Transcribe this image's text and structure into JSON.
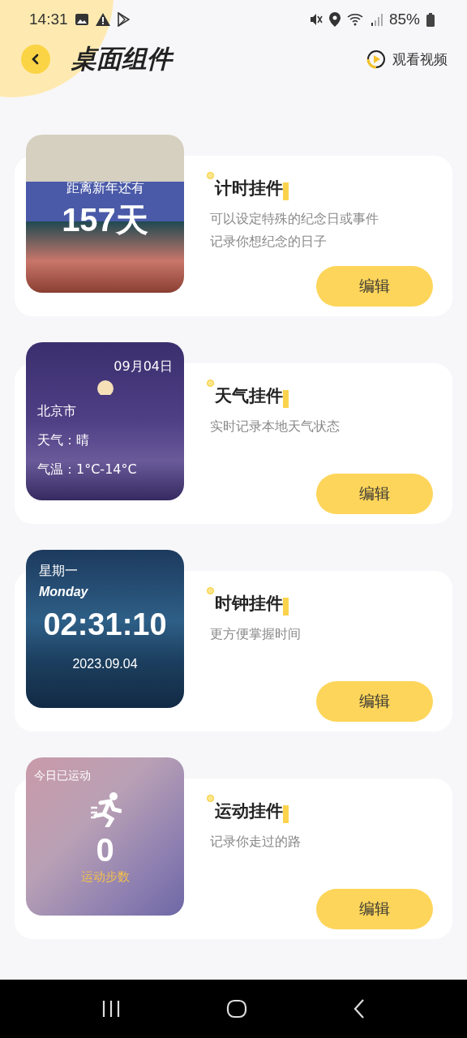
{
  "status_bar": {
    "time": "14:31",
    "battery": "85%"
  },
  "header": {
    "title": "桌面组件",
    "video_link": "观看视频"
  },
  "widgets": [
    {
      "kind": "countdown",
      "preview": {
        "label": "距离新年还有",
        "value": "157天"
      },
      "title": "计时挂件",
      "description": [
        "可以设定特殊的纪念日或事件",
        "记录你想纪念的日子"
      ],
      "button": "编辑"
    },
    {
      "kind": "weather",
      "preview": {
        "date": "09月04日",
        "city": "北京市",
        "weather": "天气：晴",
        "temperature": "气温：1°C-14°C"
      },
      "title": "天气挂件",
      "description": [
        "实时记录本地天气状态"
      ],
      "button": "编辑"
    },
    {
      "kind": "clock",
      "preview": {
        "weekday": "星期一",
        "weekday_en": "Monday",
        "time": "02:31:10",
        "date": "2023.09.04"
      },
      "title": "时钟挂件",
      "description": [
        "更方便掌握时间"
      ],
      "button": "编辑"
    },
    {
      "kind": "steps",
      "preview": {
        "label": "今日已运动",
        "value": "0",
        "caption": "运动步数"
      },
      "title": "运动挂件",
      "description": [
        "记录你走过的路"
      ],
      "button": "编辑"
    }
  ]
}
